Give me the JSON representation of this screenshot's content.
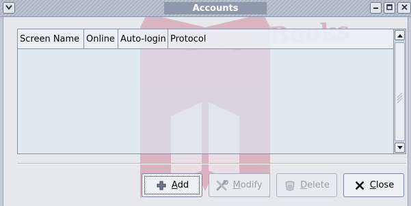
{
  "window": {
    "title": "Accounts"
  },
  "list": {
    "columns": [
      "Screen Name",
      "Online",
      "Auto-login",
      "Protocol"
    ],
    "rows": []
  },
  "buttons": {
    "add": {
      "mnemonic": "A",
      "rest": "dd",
      "enabled": true
    },
    "modify": {
      "mnemonic": "M",
      "rest": "odify",
      "enabled": false
    },
    "delete": {
      "mnemonic": "D",
      "rest": "elete",
      "enabled": false
    },
    "close": {
      "mnemonic": "C",
      "rest": "lose",
      "enabled": true
    }
  },
  "icons": {
    "window_menu": "chevron-down-icon",
    "minimize": "minimize-icon",
    "maximize": "maximize-icon",
    "close": "close-icon",
    "add": "plus-icon",
    "modify": "tools-icon",
    "delete": "trash-icon",
    "close_button": "x-icon"
  },
  "colors": {
    "titlebar_bg": "#a9b3c2",
    "title_bg": "#8e98ab",
    "list_bg": "#dce8f6",
    "watermark": "#c0506a"
  }
}
